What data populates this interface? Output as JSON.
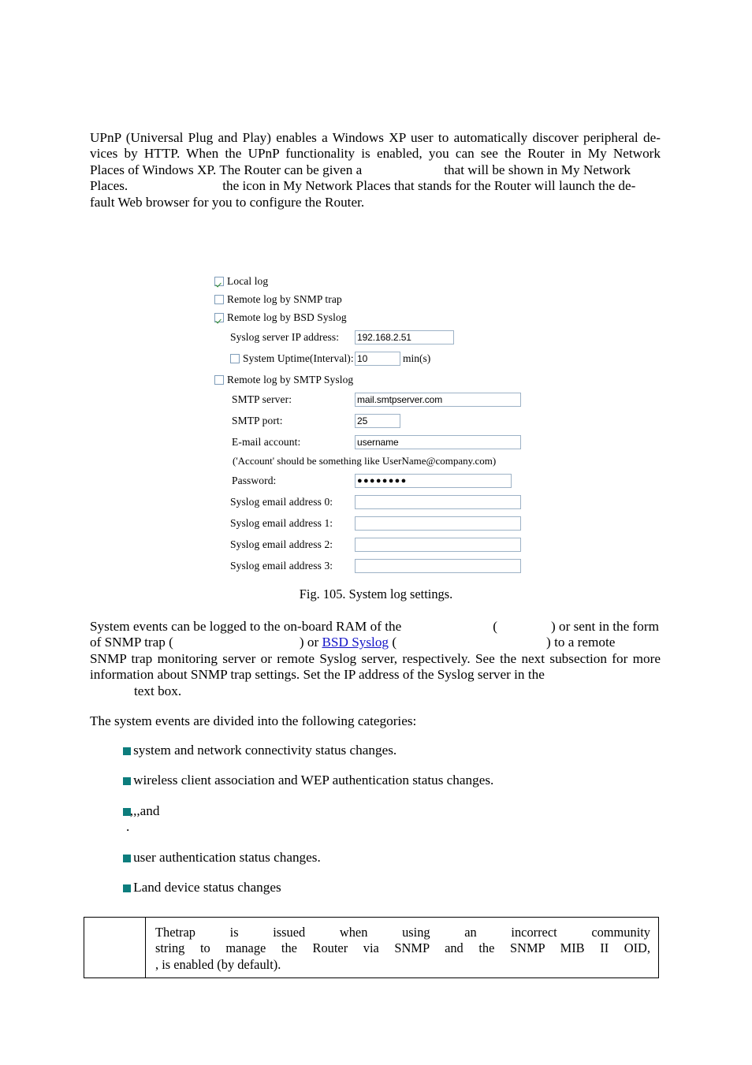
{
  "document": {
    "intro_paragraph": {
      "line1": "UPnP (Universal Plug and Play) enables a Windows XP user to automatically discover peripheral de-",
      "line2": "vices by HTTP. When the UPnP functionality is enabled, you can see the Router in My Network",
      "line3_a": "Places of Windows XP. The Router can be given a",
      "line3_b": "that will be shown in My Network",
      "line4_a": "Places.",
      "line4_b": "the icon in My Network Places that stands for the Router will launch the de-",
      "line5": "fault Web browser for you to configure the Router."
    },
    "figure": {
      "caption": "Fig. 105. System log settings.",
      "checkboxes": [
        {
          "label": "Local log",
          "checked": true
        },
        {
          "label": "Remote log by SNMP trap",
          "checked": false
        },
        {
          "label": "Remote log by BSD Syslog",
          "checked": true
        },
        {
          "label": "Remote log by SMTP Syslog",
          "checked": false
        }
      ],
      "syslog_server": {
        "label": "Syslog server IP address:",
        "value": "192.168.2.51"
      },
      "system_uptime": {
        "label": "System Uptime(Interval):",
        "checked": false,
        "value": "10",
        "unit": "min(s)"
      },
      "smtp_server": {
        "label": "SMTP server:",
        "value": "mail.smtpserver.com"
      },
      "smtp_port": {
        "label": "SMTP port:",
        "value": "25"
      },
      "email_account": {
        "label": "E-mail account:",
        "value": "username"
      },
      "account_hint": "('Account' should be something like UserName@company.com)",
      "password": {
        "label": "Password:",
        "value": "●●●●●●●●"
      },
      "syslog_emails": [
        {
          "label": "Syslog email address 0:",
          "value": ""
        },
        {
          "label": "Syslog email address 1:",
          "value": ""
        },
        {
          "label": "Syslog email address 2:",
          "value": ""
        },
        {
          "label": "Syslog email address 3:",
          "value": ""
        }
      ]
    },
    "events_paragraph": {
      "line1_a": "System events can be logged to the on-board RAM of the",
      "line1_b": "(",
      "line1_c": ") or sent in the form",
      "line2_a": "of SNMP trap (",
      "line2_link": "BSD Syslog",
      "line2_b": ") or",
      "line2_c": "(",
      "line2_d": ") to a remote",
      "line3": "SNMP trap monitoring server or remote Syslog server, respectively. See the next subsection for more",
      "line4": "information about SNMP trap settings. Set the IP address of the Syslog server in the",
      "line5": "text box."
    },
    "categories_intro": "The system events are divided into the following categories:",
    "bullets": [
      {
        "text": ": system and network connectivity status changes.",
        "indent": 133
      },
      {
        "text": ": wireless client association and WEP authentication status changes.",
        "indent": 153
      },
      {
        "text": ":",
        "indent": 129,
        "extra_commas": [
          ", ",
          ", ",
          ", "
        ],
        "tail": "and"
      },
      {
        "text": ": user authentication status changes.",
        "indent": 288
      },
      {
        "text": ": Land device status changes",
        "indent": 224
      }
    ],
    "note_box": {
      "line1_a": "The",
      "line1_b": "trap is issued when using an incorrect community",
      "line2": "string to manage the Router via SNMP and the SNMP MIB II OID,",
      "line3_a": ", is enabled (",
      "line3_b": "by default)."
    },
    "colors": {
      "bullet_teal": "#0d7d7d",
      "link_blue": "#1414c8",
      "input_border": "#9db2c6",
      "checkbox_border": "#7f9db9",
      "check_green": "#2e8b2e"
    }
  }
}
